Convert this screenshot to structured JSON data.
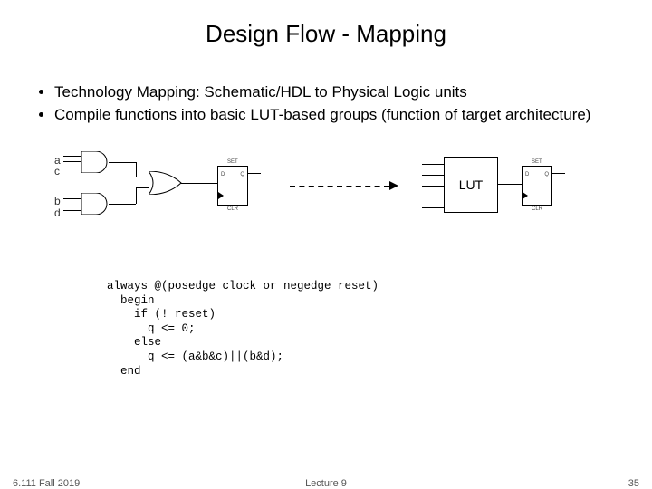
{
  "title": "Design Flow - Mapping",
  "bullets": {
    "b1": "Technology Mapping:  Schematic/HDL to Physical Logic units",
    "b2": "Compile functions into basic LUT-based groups (function of target architecture)"
  },
  "signals": {
    "a": "a",
    "c": "c",
    "b": "b",
    "d": "d"
  },
  "ff": {
    "d": "D",
    "q": "Q",
    "set": "SET",
    "clr": "CLR"
  },
  "lut": {
    "label": "LUT"
  },
  "code": {
    "l1": "always @(posedge clock or negedge reset)",
    "l2": "  begin",
    "l3": "    if (! reset)",
    "l4": "      q <= 0;",
    "l5": "    else",
    "l6": "      q <= (a&b&c)||(b&d);",
    "l7": "  end"
  },
  "footer": {
    "left": "6.111 Fall 2019",
    "center": "Lecture 9",
    "right": "35"
  }
}
